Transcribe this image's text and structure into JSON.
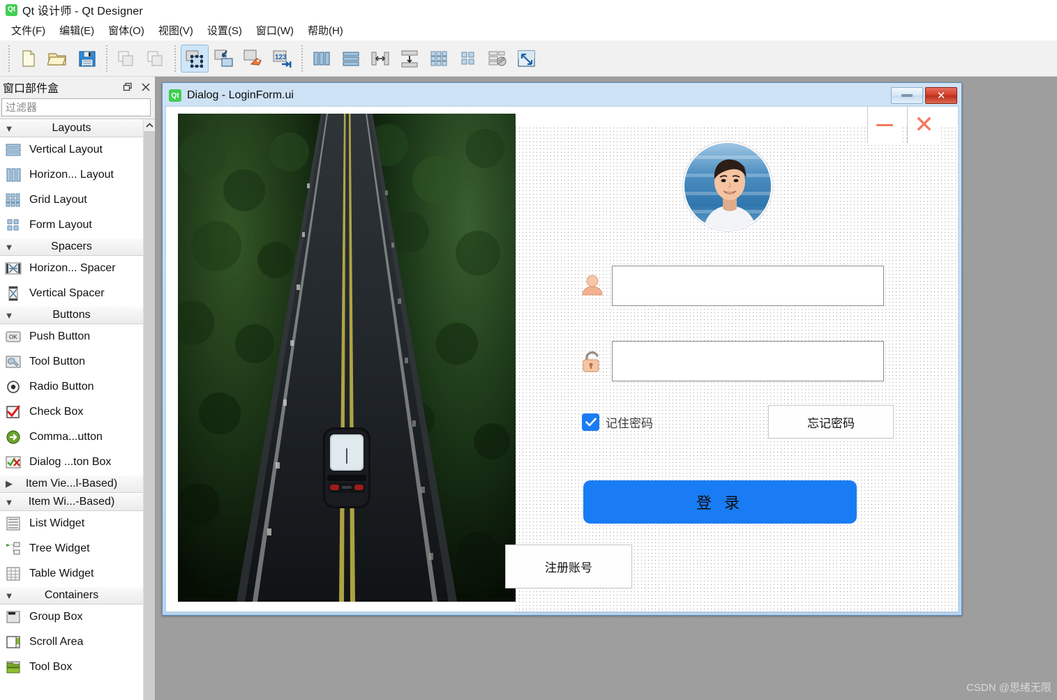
{
  "window": {
    "title": "Qt 设计师 - Qt Designer",
    "logo_text": "Qt"
  },
  "menubar": {
    "items": [
      {
        "label": "文件(F)",
        "name": "menu-file"
      },
      {
        "label": "编辑(E)",
        "name": "menu-edit"
      },
      {
        "label": "窗体(O)",
        "name": "menu-form"
      },
      {
        "label": "视图(V)",
        "name": "menu-view"
      },
      {
        "label": "设置(S)",
        "name": "menu-settings"
      },
      {
        "label": "窗口(W)",
        "name": "menu-window"
      },
      {
        "label": "帮助(H)",
        "name": "menu-help"
      }
    ]
  },
  "toolbar": {
    "groups": [
      {
        "buttons": [
          {
            "icon": "new-file-icon",
            "active": false
          },
          {
            "icon": "open-folder-icon",
            "active": false
          },
          {
            "icon": "save-icon",
            "active": false
          }
        ]
      },
      {
        "buttons": [
          {
            "icon": "copy-icon",
            "active": false
          },
          {
            "icon": "paste-icon",
            "active": false
          }
        ]
      },
      {
        "buttons": [
          {
            "icon": "edit-widgets-icon",
            "active": true
          },
          {
            "icon": "edit-signals-slots-icon",
            "active": false
          },
          {
            "icon": "edit-buddies-icon",
            "active": false
          },
          {
            "icon": "edit-tab-order-icon",
            "active": false
          }
        ]
      },
      {
        "buttons": [
          {
            "icon": "layout-horizontally-icon",
            "active": false
          },
          {
            "icon": "layout-vertically-icon",
            "active": false
          },
          {
            "icon": "layout-splitter-horizontal-icon",
            "active": false
          },
          {
            "icon": "layout-splitter-vertical-icon",
            "active": false
          },
          {
            "icon": "layout-grid-icon",
            "active": false
          },
          {
            "icon": "layout-form-icon",
            "active": false
          },
          {
            "icon": "break-layout-icon",
            "active": false
          },
          {
            "icon": "adjust-size-icon",
            "active": false
          }
        ]
      }
    ]
  },
  "widget_box": {
    "title": "窗口部件盒",
    "float_button": "restore-icon",
    "close_button": "close-icon",
    "filter": {
      "placeholder": "过滤器",
      "value": ""
    },
    "sections": [
      {
        "label": "Layouts",
        "expanded": true,
        "chevron": "chevron-down-icon",
        "items": [
          {
            "label": "Vertical Layout",
            "icon": "vertical-layout-icon"
          },
          {
            "label": "Horizon... Layout",
            "icon": "horizontal-layout-icon"
          },
          {
            "label": "Grid Layout",
            "icon": "grid-layout-icon"
          },
          {
            "label": "Form Layout",
            "icon": "form-layout-icon"
          }
        ]
      },
      {
        "label": "Spacers",
        "expanded": true,
        "chevron": "chevron-down-icon",
        "items": [
          {
            "label": "Horizon... Spacer",
            "icon": "horizontal-spacer-icon"
          },
          {
            "label": "Vertical Spacer",
            "icon": "vertical-spacer-icon"
          }
        ]
      },
      {
        "label": "Buttons",
        "expanded": true,
        "chevron": "chevron-down-icon",
        "items": [
          {
            "label": "Push Button",
            "icon": "push-button-icon"
          },
          {
            "label": "Tool Button",
            "icon": "tool-button-icon"
          },
          {
            "label": "Radio Button",
            "icon": "radio-button-icon"
          },
          {
            "label": "Check Box",
            "icon": "check-box-icon"
          },
          {
            "label": "Comma...utton",
            "icon": "command-link-button-icon"
          },
          {
            "label": "Dialog ...ton Box",
            "icon": "dialog-button-box-icon"
          }
        ]
      },
      {
        "label": "Item Vie...l-Based)",
        "expanded": false,
        "chevron": "chevron-right-icon",
        "items": []
      },
      {
        "label": "Item Wi...-Based)",
        "expanded": true,
        "chevron": "chevron-down-icon",
        "items": [
          {
            "label": "List Widget",
            "icon": "list-widget-icon"
          },
          {
            "label": "Tree Widget",
            "icon": "tree-widget-icon"
          },
          {
            "label": "Table Widget",
            "icon": "table-widget-icon"
          }
        ]
      },
      {
        "label": "Containers",
        "expanded": true,
        "chevron": "chevron-down-icon",
        "items": [
          {
            "label": "Group Box",
            "icon": "group-box-icon"
          },
          {
            "label": "Scroll Area",
            "icon": "scroll-area-icon"
          },
          {
            "label": "Tool Box",
            "icon": "tool-box-icon"
          }
        ]
      }
    ],
    "scroll_up_arrow": "chevron-up-icon"
  },
  "form_window": {
    "logo_text": "Qt",
    "title": "Dialog - LoginForm.ui",
    "minimize_label": "",
    "close_label": "✕"
  },
  "login_form": {
    "banner_alt": "forest-road-car-image",
    "avatar_alt": "user-avatar-photo",
    "minimize_icon": "minimize-icon",
    "close_icon": "close-icon",
    "username": {
      "value": "",
      "placeholder": "",
      "icon": "user-icon"
    },
    "password": {
      "value": "",
      "placeholder": "",
      "icon": "lock-icon"
    },
    "remember": {
      "label": "记住密码",
      "checked": true,
      "check_icon": "check-icon"
    },
    "forgot_button": "忘记密码",
    "login_button": "登 录",
    "register_button": "注册账号",
    "accent_color": "#1a7cf5",
    "icon_color": "#f4795c"
  },
  "footer": {
    "watermark": "CSDN @思绪无限"
  }
}
